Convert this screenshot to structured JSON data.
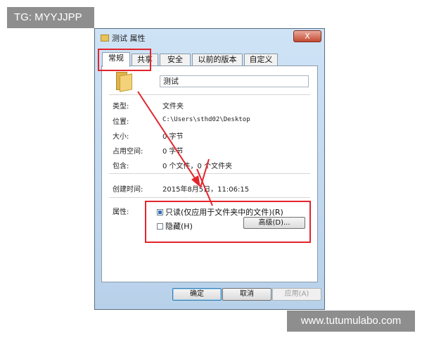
{
  "watermarks": {
    "top_left": "TG: MYYJJPP",
    "bottom_right": "www.tutumulabo.com"
  },
  "dialog": {
    "title": "测试 属性",
    "close_glyph": "X",
    "folder_icon": "folder-icon",
    "tabs": [
      {
        "label": "常规",
        "active": true
      },
      {
        "label": "共享",
        "active": false
      },
      {
        "label": "安全",
        "active": false
      },
      {
        "label": "以前的版本",
        "active": false
      },
      {
        "label": "自定义",
        "active": false
      }
    ],
    "name_value": "测试",
    "props": {
      "type_label": "类型:",
      "type_value": "文件夹",
      "location_label": "位置:",
      "location_value": "C:\\Users\\sthd02\\Desktop",
      "size_label": "大小:",
      "size_value": "0 字节",
      "disk_label": "占用空间:",
      "disk_value": "0 字节",
      "contains_label": "包含:",
      "contains_value": "0 个文件，0 个文件夹",
      "created_label": "创建时间:",
      "created_value": "2015年8月5日，11:06:15",
      "attributes_label": "属性:"
    },
    "attributes": {
      "readonly_label": "只读(仅应用于文件夹中的文件)(R)",
      "readonly_state": "indeterminate",
      "hidden_label": "隐藏(H)",
      "hidden_state": "unchecked",
      "advanced_button": "高级(D)..."
    },
    "buttons": {
      "ok": "确定",
      "cancel": "取消",
      "apply": "应用(A)"
    }
  },
  "colors": {
    "highlight": "#e3242b",
    "watermark_bg": "#8e8e8e",
    "dialog_frame": "#c5dbf1"
  }
}
